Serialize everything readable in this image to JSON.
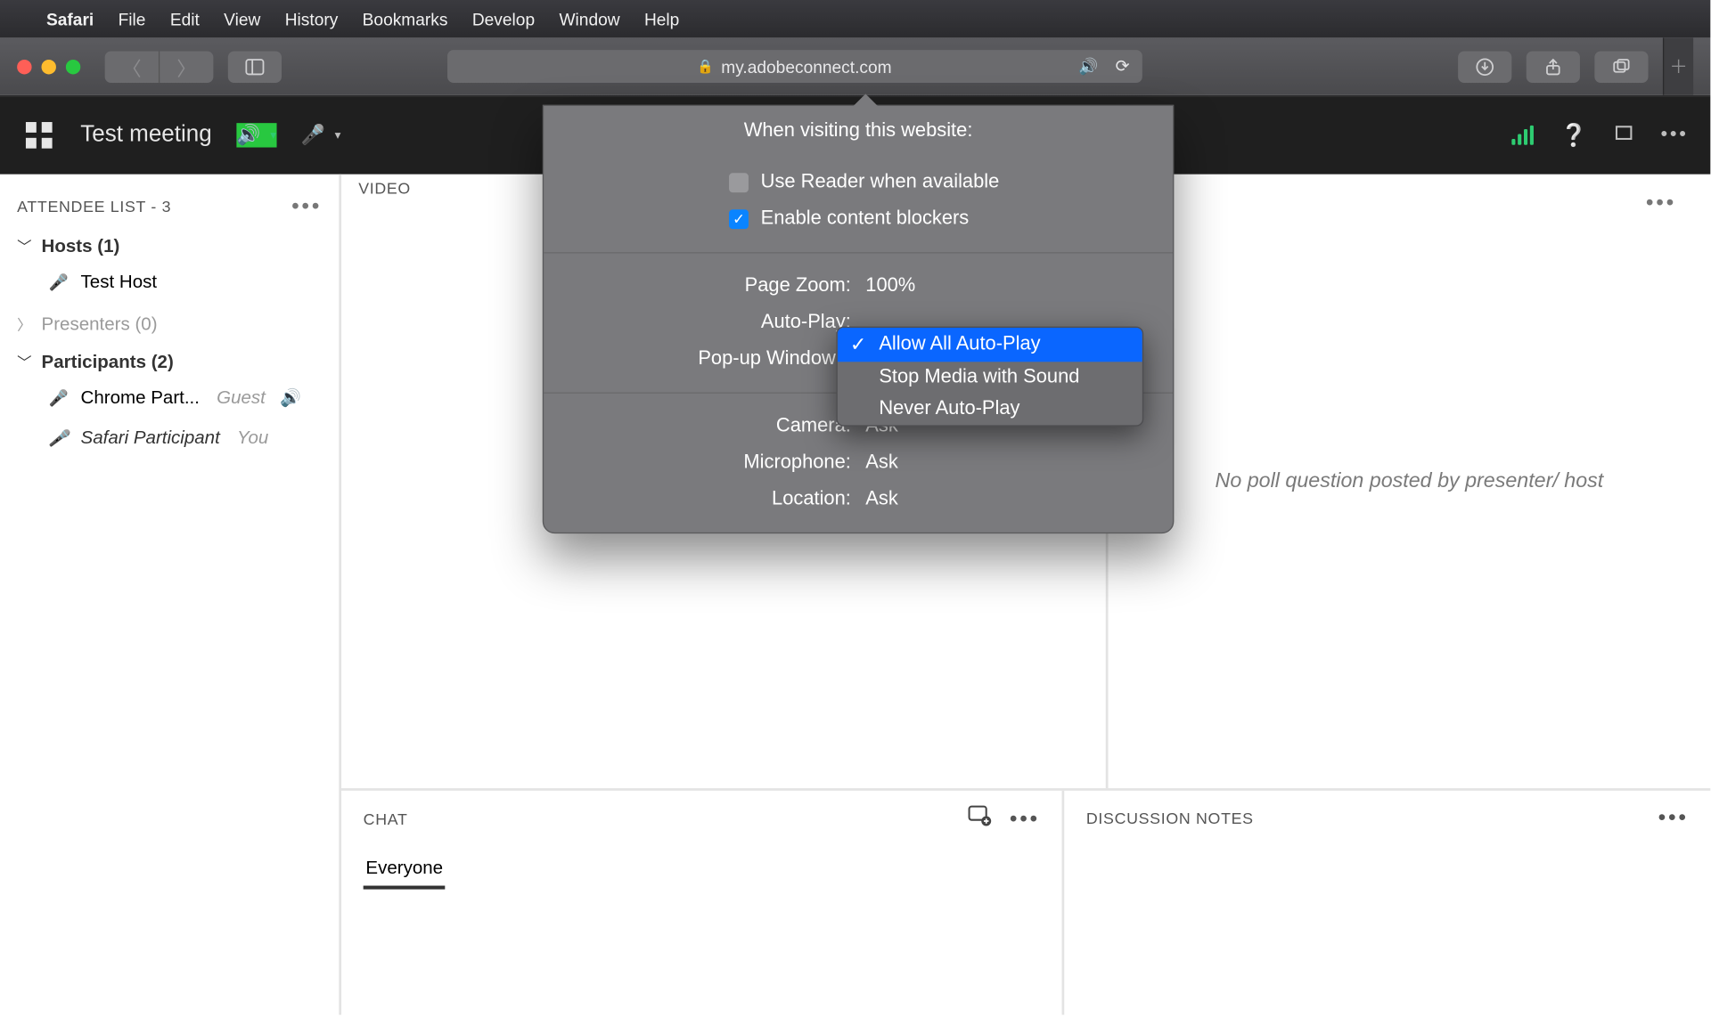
{
  "menubar": {
    "items": [
      "Safari",
      "File",
      "Edit",
      "View",
      "History",
      "Bookmarks",
      "Develop",
      "Window",
      "Help"
    ]
  },
  "toolbar": {
    "address": "my.adobeconnect.com"
  },
  "ac": {
    "title": "Test meeting",
    "attendee_header": "ATTENDEE LIST - 3",
    "groups": {
      "hosts": {
        "label": "Hosts (1)",
        "items": [
          {
            "name": "Test Host"
          }
        ]
      },
      "presenters": {
        "label": "Presenters (0)"
      },
      "participants": {
        "label": "Participants (2)",
        "items": [
          {
            "name": "Chrome Part...",
            "tag": "Guest",
            "speaking": true
          },
          {
            "name": "Safari Participant",
            "tag": "You",
            "italic": true
          }
        ]
      }
    },
    "video_header": "VIDEO",
    "poll_text": "No poll question posted by presenter/ host",
    "chat_header": "CHAT",
    "chat_tab": "Everyone",
    "notes_header": "DISCUSSION NOTES"
  },
  "popover": {
    "title": "When visiting this website:",
    "reader": "Use Reader when available",
    "blockers": "Enable content blockers",
    "page_zoom_k": "Page Zoom:",
    "page_zoom_v": "100%",
    "autoplay_k": "Auto-Play:",
    "popup_k": "Pop-up Windows:",
    "camera_k": "Camera:",
    "camera_v": "Ask",
    "mic_k": "Microphone:",
    "mic_v": "Ask",
    "loc_k": "Location:",
    "loc_v": "Ask"
  },
  "dropdown": {
    "items": [
      "Allow All Auto-Play",
      "Stop Media with Sound",
      "Never Auto-Play"
    ],
    "selected": 0
  }
}
